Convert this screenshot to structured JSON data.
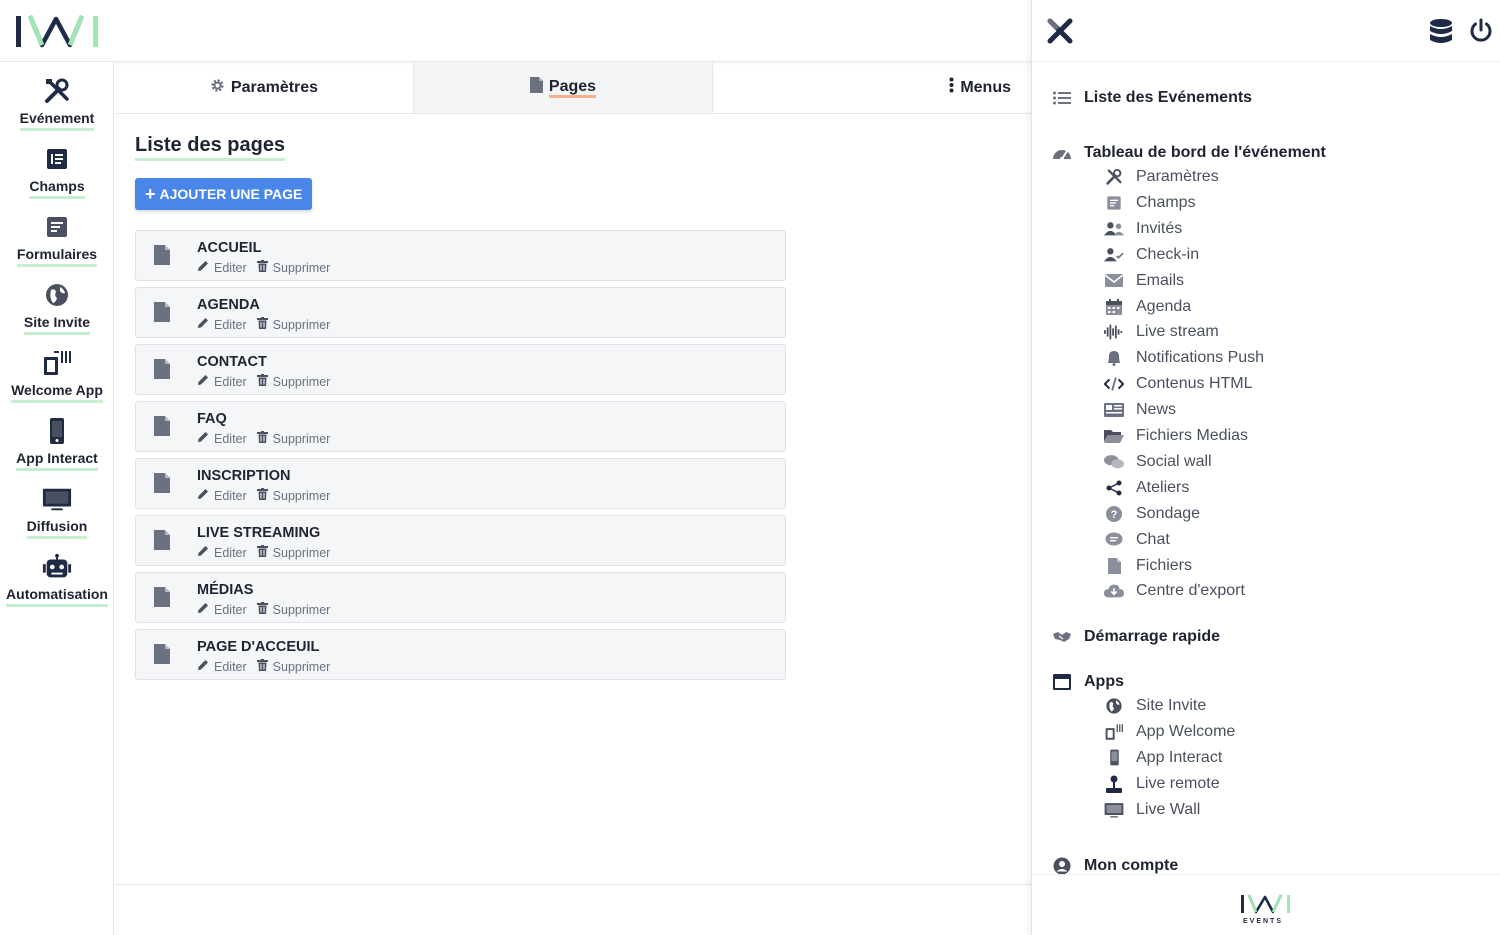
{
  "brand": {
    "logo_text": "IWI",
    "footer_logo_text": "IWI",
    "footer_logo_sub": "EVENTS",
    "accent": "#4a86e8",
    "highlight_green": "#c5efcf",
    "highlight_orange": "#f7b08a"
  },
  "left_nav": {
    "items": [
      {
        "label": "Evénement",
        "icon": "tools-icon"
      },
      {
        "label": "Champs",
        "icon": "list-box-icon"
      },
      {
        "label": "Formulaires",
        "icon": "form-icon"
      },
      {
        "label": "Site Invite",
        "icon": "globe-icon"
      },
      {
        "label": "Welcome App",
        "icon": "tablet-wifi-icon"
      },
      {
        "label": "App Interact",
        "icon": "phone-icon"
      },
      {
        "label": "Diffusion",
        "icon": "monitor-icon"
      },
      {
        "label": "Automatisation",
        "icon": "robot-icon"
      }
    ]
  },
  "tabs": [
    {
      "label": "Paramètres",
      "icon": "gear-icon"
    },
    {
      "label": "Pages",
      "icon": "document-icon",
      "active": true
    },
    {
      "label": "Menus",
      "icon": "vertical-dots-icon"
    }
  ],
  "main": {
    "title": "Liste des pages",
    "add_button": "AJOUTER UNE PAGE",
    "edit_label": "Editer",
    "delete_label": "Supprimer",
    "pages": [
      {
        "name": "ACCUEIL"
      },
      {
        "name": "AGENDA"
      },
      {
        "name": "CONTACT"
      },
      {
        "name": "FAQ"
      },
      {
        "name": "INSCRIPTION"
      },
      {
        "name": "LIVE STREAMING"
      },
      {
        "name": "MÉDIAS"
      },
      {
        "name": "PAGE D'ACCEUIL"
      }
    ]
  },
  "right_panel": {
    "events_list": "Liste des Evénements",
    "dashboard": {
      "title": "Tableau de bord de l'événement",
      "items": [
        {
          "label": "Paramètres",
          "icon": "tools-icon"
        },
        {
          "label": "Champs",
          "icon": "list-box-icon"
        },
        {
          "label": "Invités",
          "icon": "users-icon"
        },
        {
          "label": "Check-in",
          "icon": "user-check-icon"
        },
        {
          "label": "Emails",
          "icon": "envelope-icon"
        },
        {
          "label": "Agenda",
          "icon": "calendar-icon"
        },
        {
          "label": "Live stream",
          "icon": "soundwave-icon"
        },
        {
          "label": "Notifications Push",
          "icon": "bell-icon"
        },
        {
          "label": "Contenus HTML",
          "icon": "code-icon"
        },
        {
          "label": "News",
          "icon": "newspaper-icon"
        },
        {
          "label": "Fichiers Medias",
          "icon": "folder-open-icon"
        },
        {
          "label": "Social wall",
          "icon": "comments-icon"
        },
        {
          "label": "Ateliers",
          "icon": "share-nodes-icon"
        },
        {
          "label": "Sondage",
          "icon": "question-icon"
        },
        {
          "label": "Chat",
          "icon": "chat-bubble-icon"
        },
        {
          "label": "Fichiers",
          "icon": "file-icon"
        },
        {
          "label": "Centre d'export",
          "icon": "cloud-download-icon"
        }
      ]
    },
    "quick_start": "Démarrage rapide",
    "apps": {
      "title": "Apps",
      "items": [
        {
          "label": "Site Invite",
          "icon": "globe-icon"
        },
        {
          "label": "App Welcome",
          "icon": "tablet-wifi-icon"
        },
        {
          "label": "App Interact",
          "icon": "phone-icon"
        },
        {
          "label": "Live remote",
          "icon": "joystick-icon"
        },
        {
          "label": "Live Wall",
          "icon": "monitor-icon"
        }
      ]
    },
    "account": "Mon compte"
  }
}
